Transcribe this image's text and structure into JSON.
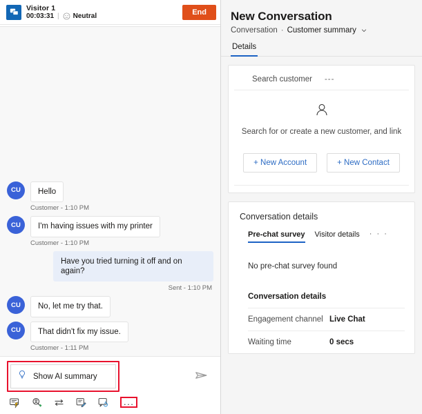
{
  "chat": {
    "header": {
      "avatar_icon": "chat-bubbles-icon",
      "visitor_name": "Visitor 1",
      "timer": "00:03:31",
      "separator": "|",
      "sentiment_icon": "neutral-face-icon",
      "sentiment_label": "Neutral",
      "end_button": "End"
    },
    "messages": [
      {
        "side": "customer",
        "avatar": "CU",
        "text": "Hello",
        "meta": "Customer - 1:10 PM",
        "show_meta": true
      },
      {
        "side": "customer",
        "avatar": "CU",
        "text": "I'm having issues with my printer",
        "meta": "Customer - 1:10 PM",
        "show_meta": true
      },
      {
        "side": "agent",
        "avatar": "",
        "text": "Have you tried turning it off and on again?",
        "meta": "Sent - 1:10 PM",
        "show_meta": true
      },
      {
        "side": "customer",
        "avatar": "CU",
        "text": "No, let me try that.",
        "meta": "",
        "show_meta": false
      },
      {
        "side": "customer",
        "avatar": "CU",
        "text": "That didn't fix my issue.",
        "meta": "Customer - 1:11 PM",
        "show_meta": true
      }
    ],
    "composer": {
      "ai_summary_label": "Show AI summary",
      "ai_summary_icon": "lightbulb-icon",
      "send_icon": "send-paper-plane-icon",
      "highlight_color": "#e8112d"
    },
    "toolbar": {
      "items": [
        {
          "icon": "quick-replies-icon",
          "name": "quick-replies"
        },
        {
          "icon": "search-add-person-icon",
          "name": "search-knowledge-article"
        },
        {
          "icon": "transfer-arrows-icon",
          "name": "transfer-conversation"
        },
        {
          "icon": "notes-edit-icon",
          "name": "notes"
        },
        {
          "icon": "consult-chat-icon",
          "name": "consult"
        }
      ],
      "more_label": "...",
      "more_icon": "more-ellipsis-icon"
    }
  },
  "details": {
    "title": "New Conversation",
    "breadcrumb": {
      "first": "Conversation",
      "separator": "·",
      "second": "Customer summary",
      "chevron_icon": "chevron-down-icon"
    },
    "tabs": [
      {
        "label": "Details",
        "active": true
      }
    ],
    "customer_card": {
      "search_label": "Search customer",
      "search_value": "---",
      "empty_icon": "person-outline-icon",
      "empty_hint": "Search for or create a new customer, and link",
      "new_account_button": "+ New Account",
      "new_contact_button": "+ New Contact"
    },
    "conversation_card": {
      "heading": "Conversation details",
      "tabs": [
        {
          "label": "Pre-chat survey",
          "active": true
        },
        {
          "label": "Visitor details",
          "active": false
        },
        {
          "label": "· · ·",
          "active": false,
          "is_overflow": true
        }
      ],
      "empty_text": "No pre-chat survey found",
      "section_heading": "Conversation details",
      "fields": [
        {
          "key": "Engagement channel",
          "value": "Live Chat"
        },
        {
          "key": "Waiting time",
          "value": "0 secs"
        }
      ]
    }
  },
  "colors": {
    "accent_blue": "#1b62c4",
    "link_blue": "#2d6cc4",
    "end_orange": "#e04f1a",
    "avatar_blue": "#3a62d8",
    "agent_bubble": "#e8eef9",
    "highlight_red": "#e8112d"
  }
}
